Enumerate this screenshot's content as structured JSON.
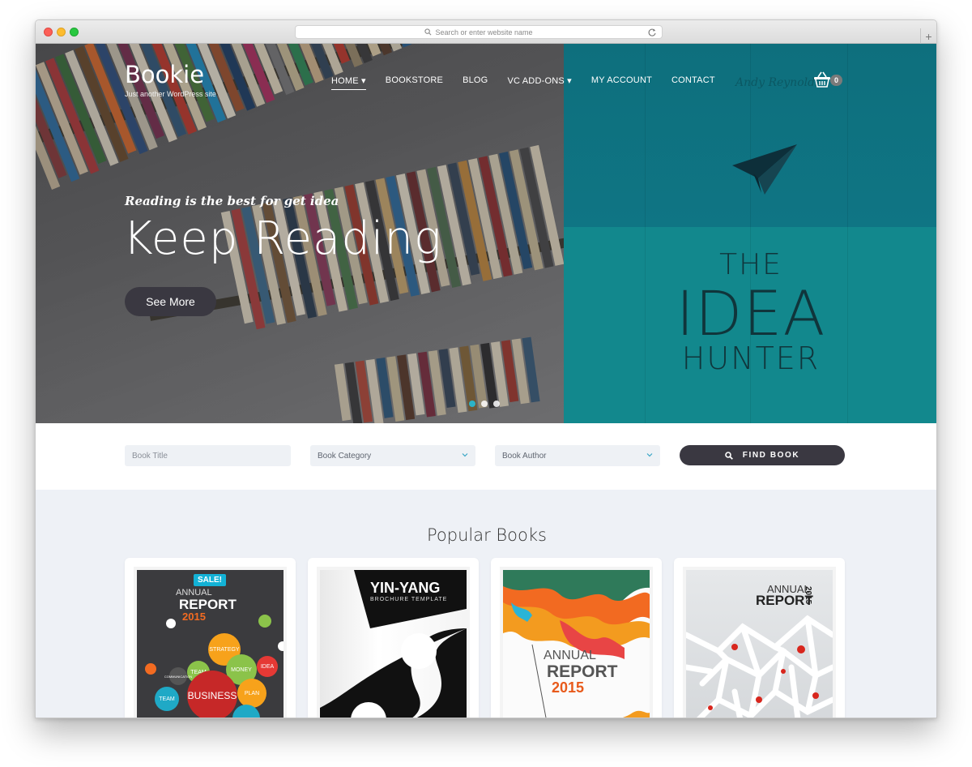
{
  "browser": {
    "address_placeholder": "Search or enter website name",
    "new_tab_label": "+"
  },
  "site": {
    "title": "Bookie",
    "tagline": "Just another WordPress site"
  },
  "nav": {
    "items": [
      {
        "label": "HOME ▾",
        "active": true
      },
      {
        "label": "BOOKSTORE"
      },
      {
        "label": "BLOG"
      },
      {
        "label": "VC ADD-ONS ▾"
      },
      {
        "label": "MY ACCOUNT"
      },
      {
        "label": "CONTACT"
      }
    ],
    "cart_count": "0"
  },
  "hero": {
    "kicker": "Reading is the best for get idea",
    "headline": "Keep Reading",
    "cta": "See More",
    "slides": 3,
    "active_slide": 0,
    "book": {
      "script": "Andy Reynolds",
      "line1": "THE",
      "line2": "IDEA",
      "line3": "HUNTER"
    }
  },
  "search": {
    "title_placeholder": "Book Title",
    "category_label": "Book Category",
    "author_label": "Book Author",
    "button_label": "FIND BOOK"
  },
  "popular": {
    "heading": "Popular Books",
    "books": [
      {
        "badge": "SALE!",
        "line1": "ANNUAL",
        "line2": "REPORT",
        "year": "2015",
        "bubbles": [
          "STRATEGY",
          "TEAM",
          "MONEY",
          "IDEA",
          "BUSINESS",
          "PLAN",
          "TEAM",
          "COMMUNICATION"
        ]
      },
      {
        "line1": "YIN-YANG",
        "line2": "BROCHURE TEMPLATE"
      },
      {
        "line1": "ANNUAL",
        "line2": "REPORT",
        "year": "2015"
      },
      {
        "line1": "ANNUAL",
        "line2": "REPORT",
        "year": "2015"
      }
    ]
  },
  "colors": {
    "teal": "#0f7d86",
    "dark_button": "#3a3841",
    "accent_blue": "#2bb3c7",
    "orange": "#e85a1b"
  }
}
